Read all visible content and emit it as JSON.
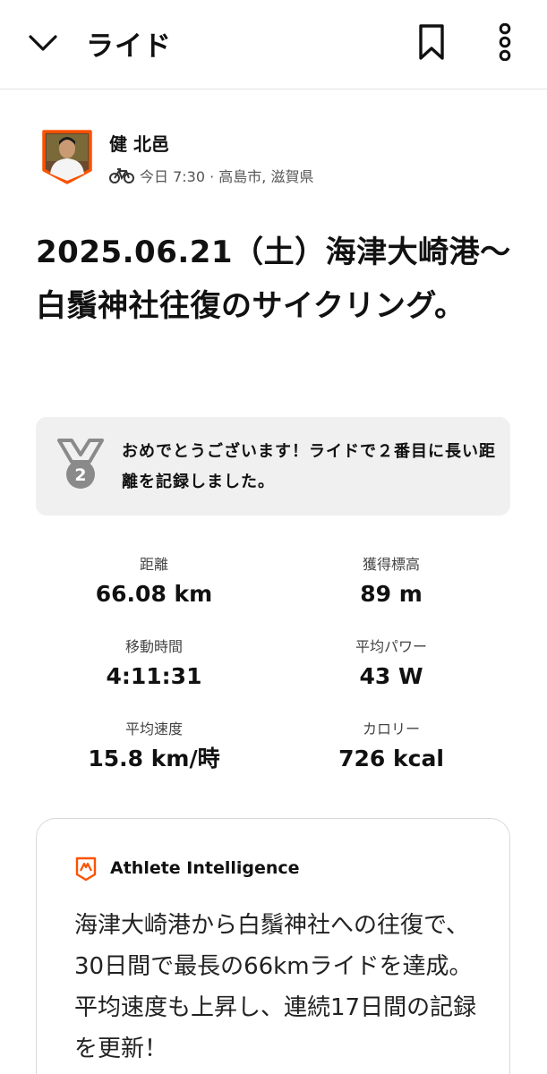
{
  "header": {
    "title": "ライド",
    "back_icon": "chevron-down-icon",
    "bookmark_icon": "bookmark-icon",
    "more_icon": "more-vertical-icon"
  },
  "athlete": {
    "name": "健 北邑",
    "activity_icon": "bike-icon",
    "meta": "今日 7:30 · 高島市, 滋賀県"
  },
  "activity": {
    "title": "2025.06.21（土）海津大崎港〜白鬚神社往復のサイクリング。"
  },
  "achievement": {
    "icon": "medal-2-icon",
    "text": "おめでとうございます！ライドで２番目に長い距離を記録しました。"
  },
  "stats": [
    {
      "label": "距離",
      "value": "66.08 km"
    },
    {
      "label": "獲得標高",
      "value": "89 m"
    },
    {
      "label": "移動時間",
      "value": "4:11:31"
    },
    {
      "label": "平均パワー",
      "value": "43 W"
    },
    {
      "label": "平均速度",
      "value": "15.8 km/時"
    },
    {
      "label": "カロリー",
      "value": "726 kcal"
    }
  ],
  "athlete_intelligence": {
    "title": "Athlete Intelligence",
    "icon": "athlete-intelligence-icon",
    "body": "海津大崎港から白鬚神社への往復で、30日間で最長の66kmライドを達成。平均速度も上昇し、連続17日間の記録を更新！"
  },
  "colors": {
    "accent": "#fc5200",
    "text": "#111111",
    "muted": "#555555",
    "card_bg": "#f0f0f0"
  }
}
